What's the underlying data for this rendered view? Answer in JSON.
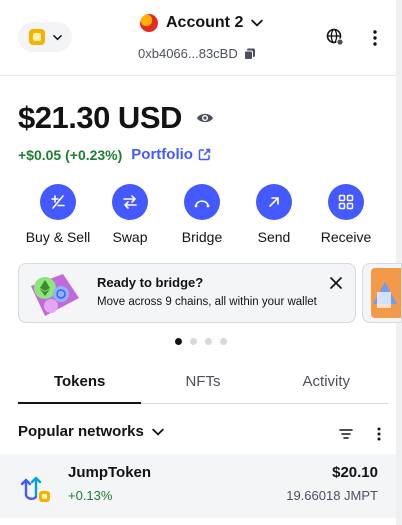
{
  "header": {
    "network_icon": "token-badge-icon",
    "account_name": "Account 2",
    "address": "0xb4066...83cBD"
  },
  "balance": {
    "amount": "$21.30 USD",
    "change": "+$0.05 (+0.23%)",
    "portfolio_label": "Portfolio"
  },
  "actions": [
    {
      "label": "Buy & Sell",
      "icon": "plus-minus-icon"
    },
    {
      "label": "Swap",
      "icon": "swap-arrows-icon"
    },
    {
      "label": "Bridge",
      "icon": "bridge-icon"
    },
    {
      "label": "Send",
      "icon": "arrow-up-right-icon"
    },
    {
      "label": "Receive",
      "icon": "qr-code-icon"
    }
  ],
  "banner": {
    "title": "Ready to bridge?",
    "text": "Move across 9 chains, all within your wallet",
    "active_slide": 1,
    "slide_count": 4
  },
  "tabs": [
    {
      "label": "Tokens",
      "active": true
    },
    {
      "label": "NFTs",
      "active": false
    },
    {
      "label": "Activity",
      "active": false
    }
  ],
  "filter": {
    "network_label": "Popular networks"
  },
  "tokens": [
    {
      "name": "JumpToken",
      "change": "+0.13%",
      "fiat": "$20.10",
      "amount": "19.66018 JMPT"
    }
  ],
  "colors": {
    "accent": "#4459ff",
    "positive": "#1c7e33",
    "text": "#121314",
    "muted": "#4b505c"
  }
}
